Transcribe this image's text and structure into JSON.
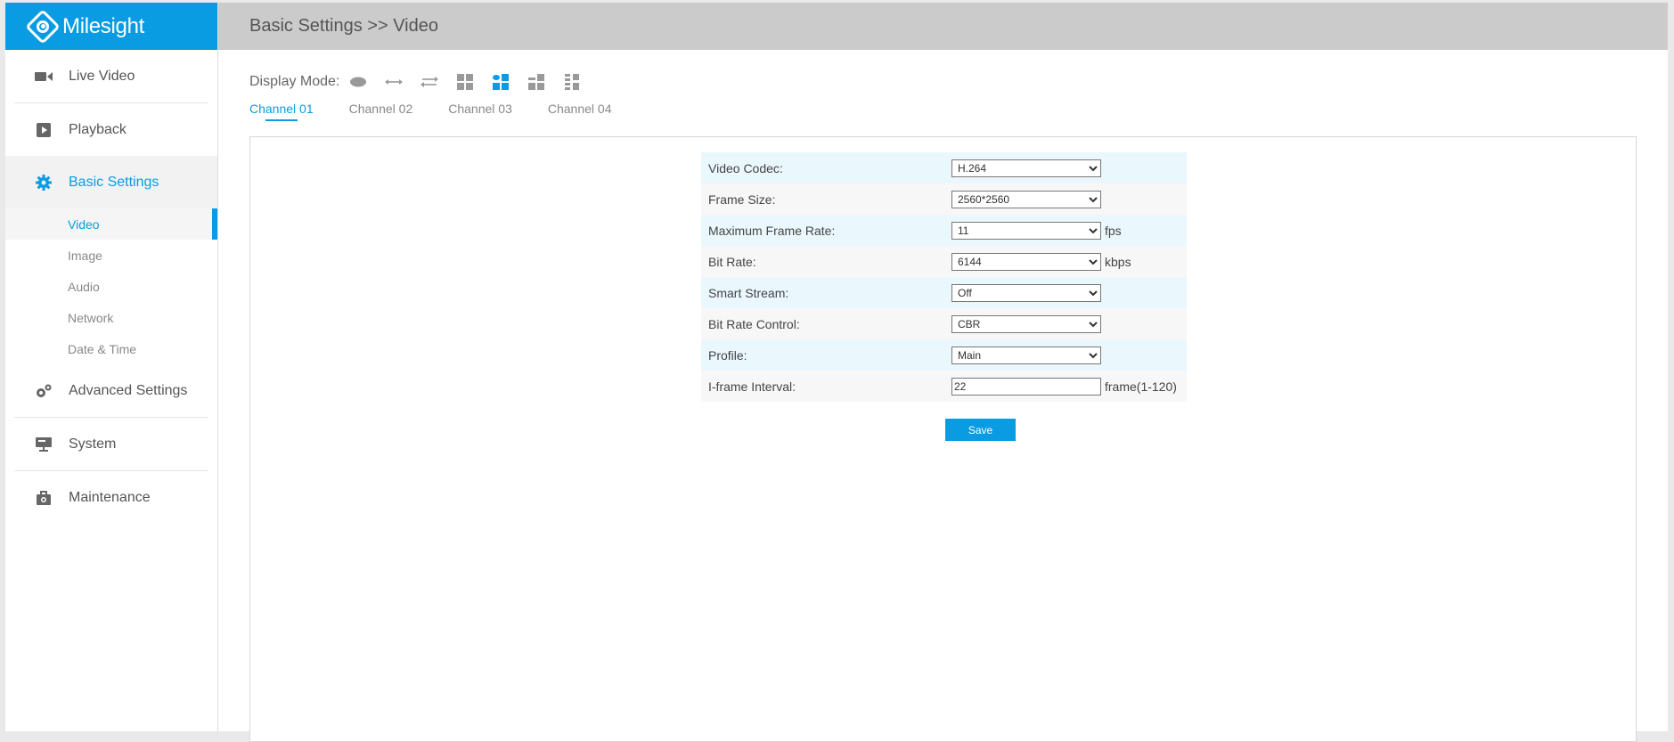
{
  "brand": {
    "name": "Milesight",
    "accent": "#0a9ce2"
  },
  "header": {
    "breadcrumb": "Basic Settings >> Video"
  },
  "sidebar": {
    "items": [
      {
        "label": "Live Video",
        "icon": "video-camera-icon"
      },
      {
        "label": "Playback",
        "icon": "play-icon"
      },
      {
        "label": "Basic Settings",
        "icon": "gear-icon"
      },
      {
        "label": "Advanced Settings",
        "icon": "gears-icon"
      },
      {
        "label": "System",
        "icon": "monitor-icon"
      },
      {
        "label": "Maintenance",
        "icon": "toolbox-icon"
      }
    ],
    "subitems": [
      "Video",
      "Image",
      "Audio",
      "Network",
      "Date & Time"
    ],
    "active_item": "Basic Settings",
    "active_subitem": "Video"
  },
  "display_mode": {
    "label": "Display Mode:"
  },
  "tabs": [
    "Channel 01",
    "Channel 02",
    "Channel 03",
    "Channel 04"
  ],
  "form": {
    "video_codec": {
      "label": "Video Codec:",
      "value": "H.264"
    },
    "frame_size": {
      "label": "Frame Size:",
      "value": "2560*2560"
    },
    "max_frame_rate": {
      "label": "Maximum Frame Rate:",
      "value": "11",
      "unit": "fps"
    },
    "bit_rate": {
      "label": "Bit Rate:",
      "value": "6144",
      "unit": "kbps"
    },
    "smart_stream": {
      "label": "Smart Stream:",
      "value": "Off"
    },
    "bit_rate_control": {
      "label": "Bit Rate Control:",
      "value": "CBR"
    },
    "profile": {
      "label": "Profile:",
      "value": "Main"
    },
    "iframe_interval": {
      "label": "I-frame Interval:",
      "value": "22",
      "unit": "frame(1-120)"
    }
  },
  "actions": {
    "save_label": "Save"
  }
}
